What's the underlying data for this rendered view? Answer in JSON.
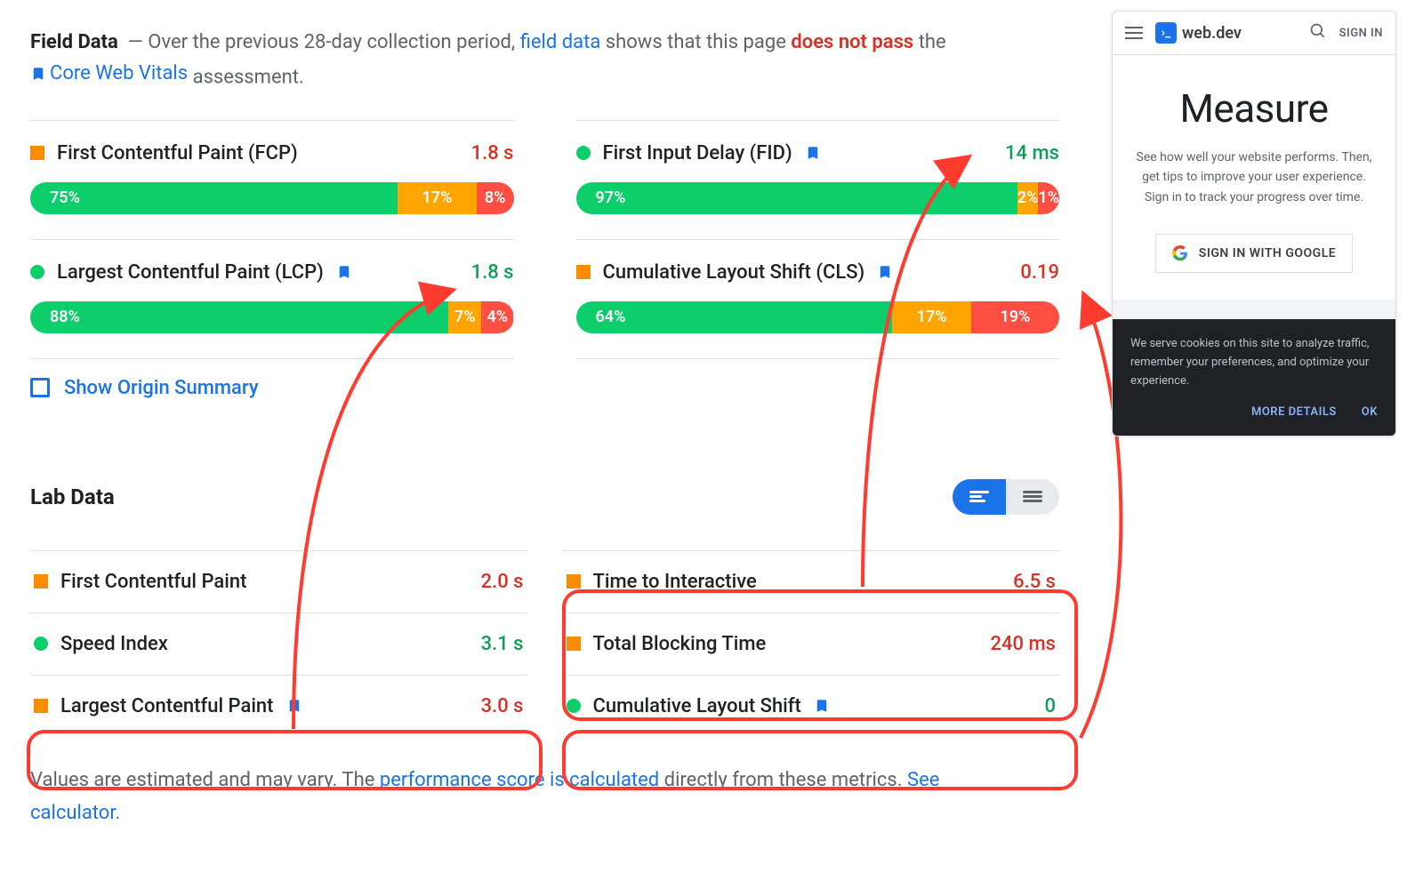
{
  "fieldData": {
    "title": "Field Data",
    "intro_prefix": "— Over the previous 28-day collection period, ",
    "field_data_link": "field data",
    "intro_mid": " shows that this page ",
    "fail_text": "does not pass",
    "intro_suffix": " the ",
    "cwv_link": "Core Web Vitals",
    "assessment_suffix": " assessment."
  },
  "metrics": {
    "fcp": {
      "name": "First Contentful Paint (FCP)",
      "value": "1.8 s",
      "dist": {
        "g": "75%",
        "o": "17%",
        "r": "8%"
      }
    },
    "lcp": {
      "name": "Largest Contentful Paint (LCP)",
      "value": "1.8 s",
      "dist": {
        "g": "88%",
        "o": "7%",
        "r": "4%"
      }
    },
    "fid": {
      "name": "First Input Delay (FID)",
      "value": "14 ms",
      "dist": {
        "g": "97%",
        "o": "2%",
        "r": "1%"
      }
    },
    "cls": {
      "name": "Cumulative Layout Shift (CLS)",
      "value": "0.19",
      "dist": {
        "g": "64%",
        "o": "17%",
        "r": "19%"
      }
    }
  },
  "originSummary": "Show Origin Summary",
  "labHeader": "Lab Data",
  "lab": {
    "fcp": {
      "name": "First Contentful Paint",
      "value": "2.0 s"
    },
    "si": {
      "name": "Speed Index",
      "value": "3.1 s"
    },
    "lcp": {
      "name": "Largest Contentful Paint",
      "value": "3.0 s"
    },
    "tti": {
      "name": "Time to Interactive",
      "value": "6.5 s"
    },
    "tbt": {
      "name": "Total Blocking Time",
      "value": "240 ms"
    },
    "cls": {
      "name": "Cumulative Layout Shift",
      "value": "0"
    }
  },
  "footer": {
    "p1": "Values are estimated and may vary. The ",
    "link1": "performance score is calculated",
    "p2": " directly from these metrics. ",
    "link2": "See calculator."
  },
  "device": {
    "brand": "web.dev",
    "signin": "SIGN IN",
    "h": "Measure",
    "p": "See how well your website performs. Then, get tips to improve your user experience. Sign in to track your progress over time.",
    "gbtn": "SIGN IN WITH GOOGLE",
    "cookie": "We serve cookies on this site to analyze traffic, remember your preferences, and optimize your experience.",
    "more": "MORE DETAILS",
    "ok": "OK"
  }
}
